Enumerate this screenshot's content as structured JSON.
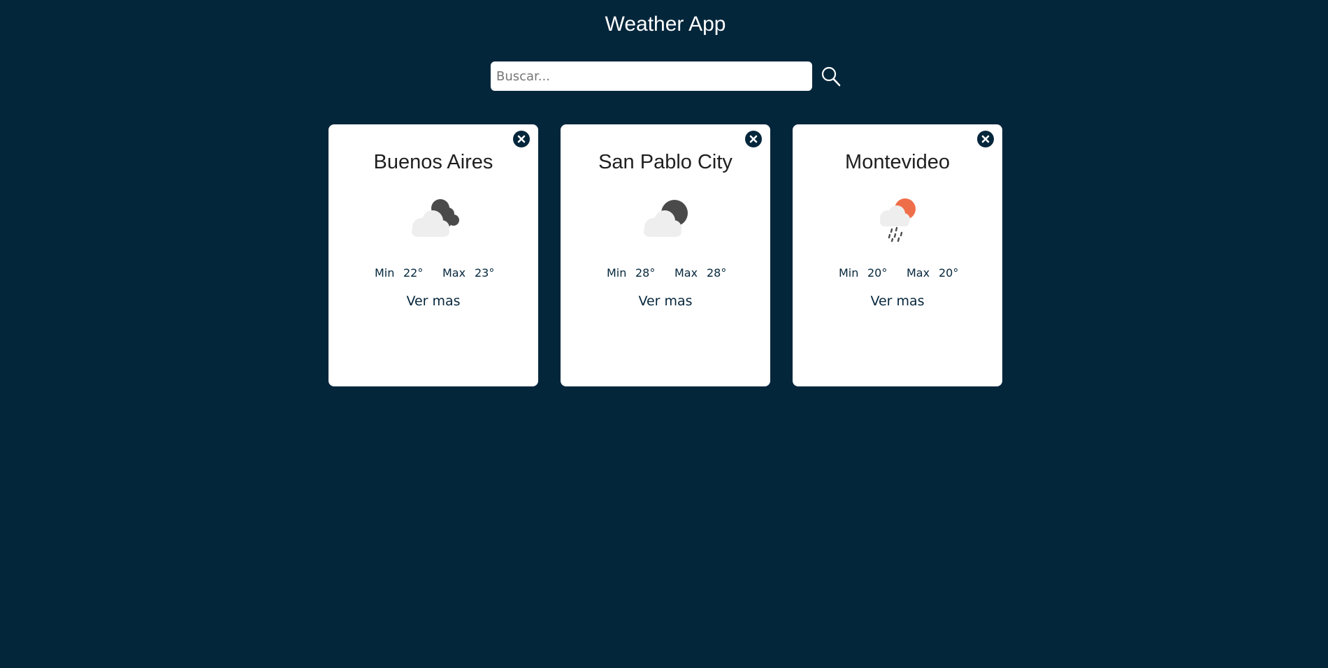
{
  "header": {
    "title": "Weather App"
  },
  "search": {
    "placeholder": "Buscar...",
    "value": "",
    "button_icon": "search-icon"
  },
  "labels": {
    "min": "Min",
    "max": "Max",
    "more": "Ver mas"
  },
  "cards": [
    {
      "city": "Buenos Aires",
      "icon": "cloud-night-icon",
      "min": "22°",
      "max": "23°"
    },
    {
      "city": "San Pablo City",
      "icon": "cloud-moon-icon",
      "min": "28°",
      "max": "28°"
    },
    {
      "city": "Montevideo",
      "icon": "rain-sun-icon",
      "min": "20°",
      "max": "20°"
    }
  ],
  "colors": {
    "background": "#04263b",
    "card": "#ffffff",
    "text_dark": "#04263b",
    "sun": "#ef6e4a",
    "moon": "#4a4a4a",
    "cloud": "#eeeeee"
  }
}
